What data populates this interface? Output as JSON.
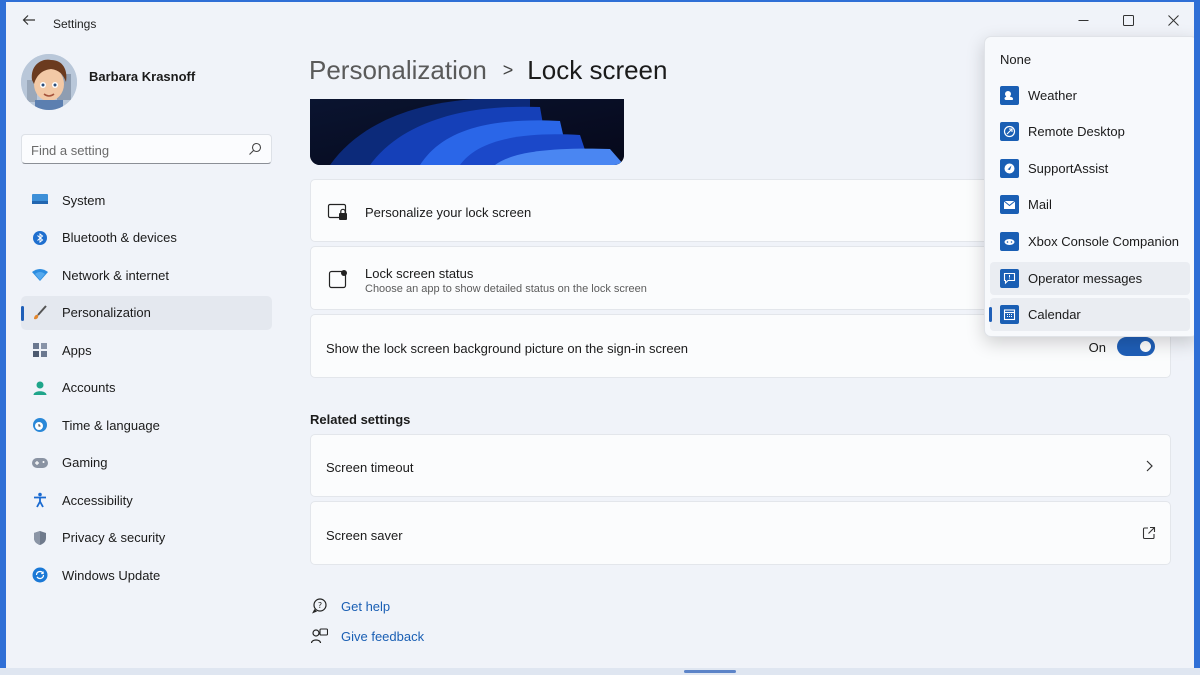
{
  "app": {
    "title": "Settings",
    "back_icon": "arrow-left-icon"
  },
  "window_controls": [
    "minimize-icon",
    "maximize-icon",
    "close-icon"
  ],
  "user": {
    "name": "Barbara Krasnoff"
  },
  "search": {
    "placeholder": "Find a setting",
    "value": ""
  },
  "sidebar": {
    "items": [
      {
        "label": "System",
        "icon": "monitor-icon"
      },
      {
        "label": "Bluetooth & devices",
        "icon": "bluetooth-icon"
      },
      {
        "label": "Network & internet",
        "icon": "wifi-icon"
      },
      {
        "label": "Personalization",
        "icon": "brush-icon",
        "active": true
      },
      {
        "label": "Apps",
        "icon": "apps-icon"
      },
      {
        "label": "Accounts",
        "icon": "person-icon"
      },
      {
        "label": "Time & language",
        "icon": "globe-clock-icon"
      },
      {
        "label": "Gaming",
        "icon": "gamepad-icon"
      },
      {
        "label": "Accessibility",
        "icon": "accessibility-icon"
      },
      {
        "label": "Privacy & security",
        "icon": "shield-icon"
      },
      {
        "label": "Windows Update",
        "icon": "sync-icon"
      }
    ]
  },
  "breadcrumb": {
    "parent": "Personalization",
    "separator": ">",
    "current": "Lock screen"
  },
  "settings": {
    "personalize": {
      "title": "Personalize your lock screen",
      "icon": "lock-monitor-icon"
    },
    "status": {
      "title": "Lock screen status",
      "subtitle": "Choose an app to show detailed status on the lock screen",
      "icon": "status-icon"
    },
    "signin": {
      "title": "Show the lock screen background picture on the sign-in screen",
      "toggle_label": "On",
      "toggle_on": true
    }
  },
  "related": {
    "title": "Related settings",
    "items": [
      {
        "label": "Screen timeout",
        "icon": "chevron-right-icon"
      },
      {
        "label": "Screen saver",
        "icon": "external-link-icon"
      }
    ]
  },
  "help": {
    "get_help": "Get help",
    "give_feedback": "Give feedback"
  },
  "dropdown": {
    "items": [
      {
        "label": "None"
      },
      {
        "label": "Weather",
        "icon": "weather-icon"
      },
      {
        "label": "Remote Desktop",
        "icon": "remote-desktop-icon"
      },
      {
        "label": "SupportAssist",
        "icon": "supportassist-icon"
      },
      {
        "label": "Mail",
        "icon": "mail-icon"
      },
      {
        "label": "Xbox Console Companion",
        "icon": "xbox-icon"
      },
      {
        "label": "Operator messages",
        "icon": "message-icon"
      },
      {
        "label": "Calendar",
        "icon": "calendar-icon",
        "selected": true
      }
    ]
  },
  "colors": {
    "accent": "#1f5fb8",
    "link": "#1a5fb4",
    "desktop": "#2f6fd6"
  }
}
